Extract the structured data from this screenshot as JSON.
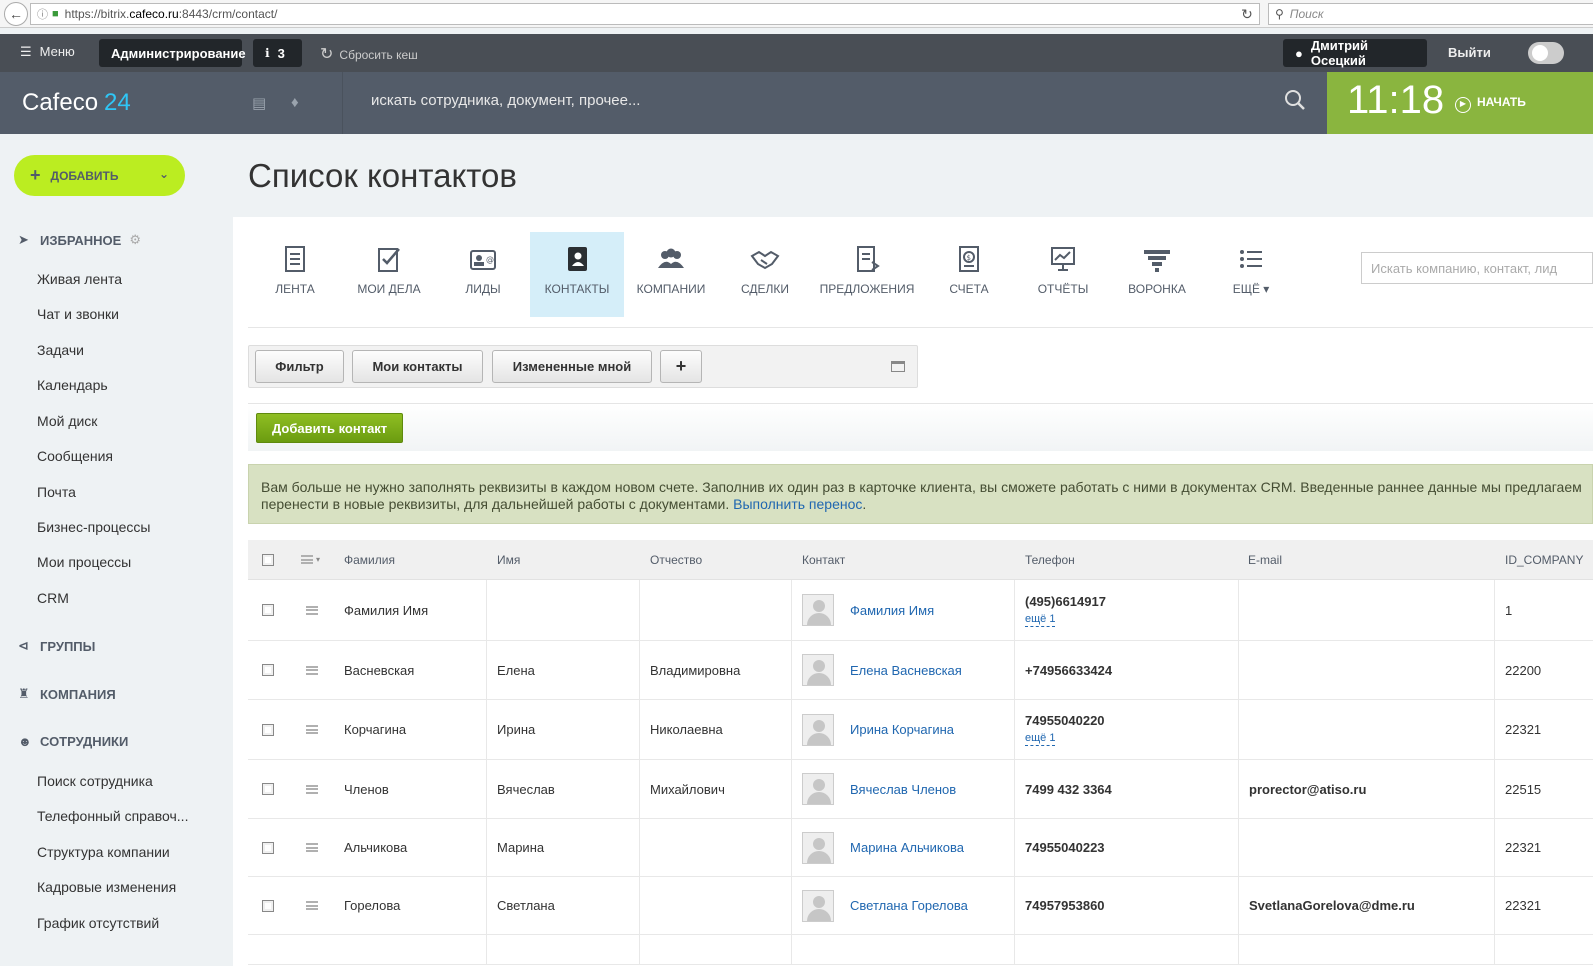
{
  "browser": {
    "url_prefix": "https://bitrix.",
    "url_domain": "cafeco.ru",
    "url_rest": ":8443/crm/contact/",
    "search_placeholder": "Поиск"
  },
  "adminbar": {
    "menu": "Меню",
    "admin": "Администрирование",
    "notif_count": "3",
    "reset_cache": "Сбросить кеш",
    "user": "Дмитрий Осецкий",
    "logout": "Выйти"
  },
  "header": {
    "logo": "Cafeco",
    "logo_num": "24",
    "search_placeholder": "искать сотрудника, документ, прочее...",
    "time": "11:18",
    "start": "НАЧАТЬ"
  },
  "sidebar": {
    "add": "ДОБАВИТЬ",
    "favorites": "ИЗБРАННОЕ",
    "fav_items": [
      "Живая лента",
      "Чат и звонки",
      "Задачи",
      "Календарь",
      "Мой диск",
      "Сообщения",
      "Почта",
      "Бизнес-процессы",
      "Мои процессы",
      "CRM"
    ],
    "groups": "ГРУППЫ",
    "company": "КОМПАНИЯ",
    "employees": "СОТРУДНИКИ",
    "emp_items": [
      "Поиск сотрудника",
      "Телефонный справоч...",
      "Структура компании",
      "Кадровые изменения",
      "График отсутствий"
    ]
  },
  "page_title": "Список контактов",
  "tabs": [
    {
      "label": "ЛЕНТА",
      "icon": "feed-icon"
    },
    {
      "label": "МОИ ДЕЛА",
      "icon": "tasks-icon"
    },
    {
      "label": "ЛИДЫ",
      "icon": "leads-icon"
    },
    {
      "label": "КОНТАКТЫ",
      "icon": "contacts-icon"
    },
    {
      "label": "КОМПАНИИ",
      "icon": "companies-icon"
    },
    {
      "label": "СДЕЛКИ",
      "icon": "deals-icon"
    },
    {
      "label": "ПРЕДЛОЖЕНИЯ",
      "icon": "quotes-icon"
    },
    {
      "label": "СЧЕТА",
      "icon": "invoices-icon"
    },
    {
      "label": "ОТЧЁТЫ",
      "icon": "reports-icon"
    },
    {
      "label": "ВОРОНКА",
      "icon": "funnel-icon"
    },
    {
      "label": "ЕЩЁ",
      "icon": "more-icon"
    }
  ],
  "crm_search_placeholder": "Искать компанию, контакт, лид",
  "filters": {
    "filter": "Фильтр",
    "my_contacts": "Мои контакты",
    "changed_by_me": "Измененные мной",
    "add": "+"
  },
  "add_contact": "Добавить контакт",
  "notice": {
    "line1": "Вам больше не нужно заполнять реквизиты в каждом новом счете. Заполнив их один раз в карточке клиента, вы сможете работать с ними в документах CRM. Введенные раннее данные мы предлагаем",
    "line2": "перенести в новые реквизиты, для дальнейшей работы с документами.",
    "link": "Выполнить перенос",
    "after": "."
  },
  "grid": {
    "columns": [
      "Фамилия",
      "Имя",
      "Отчество",
      "Контакт",
      "Телефон",
      "E-mail",
      "ID_COMPANY"
    ],
    "rows": [
      {
        "last": "Фамилия Имя",
        "first": "",
        "middle": "",
        "contact": "Фамилия Имя",
        "phone": "(495)6614917",
        "more": "ещё 1",
        "email": "",
        "id": "1"
      },
      {
        "last": "Васневская",
        "first": "Елена",
        "middle": "Владимировна",
        "contact": "Елена Васневская",
        "phone": "+74956633424",
        "more": "",
        "email": "",
        "id": "22200"
      },
      {
        "last": "Корчагина",
        "first": "Ирина",
        "middle": "Николаевна",
        "contact": "Ирина Корчагина",
        "phone": "74955040220",
        "more": "ещё 1",
        "email": "",
        "id": "22321"
      },
      {
        "last": "Членов",
        "first": "Вячеслав",
        "middle": "Михайлович",
        "contact": "Вячеслав Членов",
        "phone": "7499 432 3364",
        "more": "",
        "email": "prorector@atiso.ru",
        "id": "22515"
      },
      {
        "last": "Альчикова",
        "first": "Марина",
        "middle": "",
        "contact": "Марина Альчикова",
        "phone": "74955040223",
        "more": "",
        "email": "",
        "id": "22321"
      },
      {
        "last": "Горелова",
        "first": "Светлана",
        "middle": "",
        "contact": "Светлана Горелова",
        "phone": "74957953860",
        "more": "",
        "email": "SvetlanaGorelova@dme.ru",
        "id": "22321"
      }
    ]
  }
}
